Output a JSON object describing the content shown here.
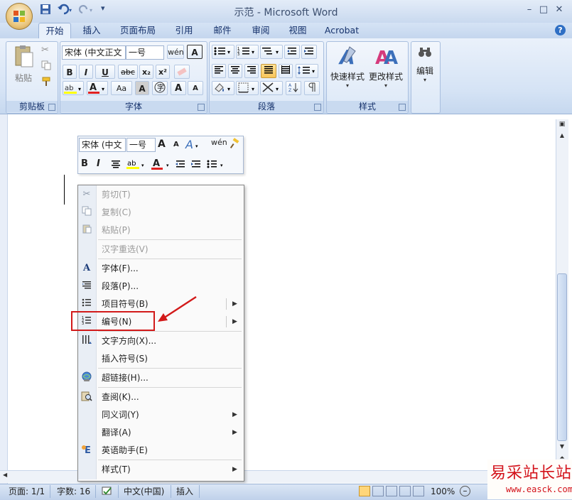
{
  "window": {
    "title": "示范 - Microsoft Word",
    "minimize": "–",
    "maximize": "□",
    "close": "✕",
    "help": "?"
  },
  "qat": {
    "save_icon": "save-icon",
    "undo_icon": "undo-icon",
    "redo_icon": "redo-icon",
    "customize": "▾"
  },
  "tabs": [
    {
      "label": "开始",
      "active": true
    },
    {
      "label": "插入"
    },
    {
      "label": "页面布局"
    },
    {
      "label": "引用"
    },
    {
      "label": "邮件"
    },
    {
      "label": "审阅"
    },
    {
      "label": "视图"
    },
    {
      "label": "Acrobat"
    }
  ],
  "ribbon": {
    "clipboard": {
      "label": "剪贴板",
      "paste": "粘贴"
    },
    "font": {
      "label": "字体",
      "font_name": "宋体 (中文正文",
      "font_size": "一号",
      "bold": "B",
      "italic": "I",
      "underline": "U",
      "strike": "abc",
      "subscript": "x₂",
      "superscript": "x²",
      "grow": "A",
      "shrink": "A",
      "case": "Aa",
      "clear": "A",
      "phonetic": "wén",
      "border_char": "A"
    },
    "paragraph": {
      "label": "段落"
    },
    "styles": {
      "label": "样式",
      "quick": "快速样式",
      "change": "更改样式"
    },
    "editing": {
      "label": "编辑"
    }
  },
  "minibar": {
    "font_name": "宋体 (中文",
    "font_size": "一号",
    "bold": "B",
    "italic": "I",
    "grow": "A",
    "shrink": "A",
    "color_a": "A"
  },
  "context_menu": {
    "items": [
      {
        "label": "剪切(T)",
        "icon": "scissors-icon",
        "disabled": true
      },
      {
        "label": "复制(C)",
        "icon": "copy-icon",
        "disabled": true
      },
      {
        "label": "粘贴(P)",
        "icon": "paste-icon",
        "disabled": true
      },
      {
        "label": "汉字重选(V)",
        "icon": "",
        "disabled": true
      },
      {
        "label": "字体(F)...",
        "icon": "font-icon"
      },
      {
        "label": "段落(P)...",
        "icon": "paragraph-icon"
      },
      {
        "label": "项目符号(B)",
        "icon": "bullets-icon",
        "submenu": true
      },
      {
        "label": "编号(N)",
        "icon": "numbering-icon",
        "submenu": true
      },
      {
        "label": "文字方向(X)...",
        "icon": "text-direction-icon"
      },
      {
        "label": "插入符号(S)",
        "icon": ""
      },
      {
        "label": "超链接(H)...",
        "icon": "hyperlink-icon"
      },
      {
        "label": "查阅(K)...",
        "icon": "research-icon"
      },
      {
        "label": "同义词(Y)",
        "icon": "",
        "submenu": true
      },
      {
        "label": "翻译(A)",
        "icon": "",
        "submenu": true
      },
      {
        "label": "英语助手(E)",
        "icon": "english-assistant-icon"
      },
      {
        "label": "样式(T)",
        "icon": "",
        "submenu": true
      }
    ]
  },
  "statusbar": {
    "page": "页面: 1/1",
    "words": "字数: 16",
    "language": "中文(中国)",
    "mode": "插入",
    "zoom": "100%"
  },
  "watermark": {
    "text": "易采站长站",
    "url": "www.easck.com"
  },
  "colors": {
    "highlight_box": "#d21a1a",
    "arrow": "#d21a1a",
    "ribbon_bg": "#d5e3f5"
  }
}
